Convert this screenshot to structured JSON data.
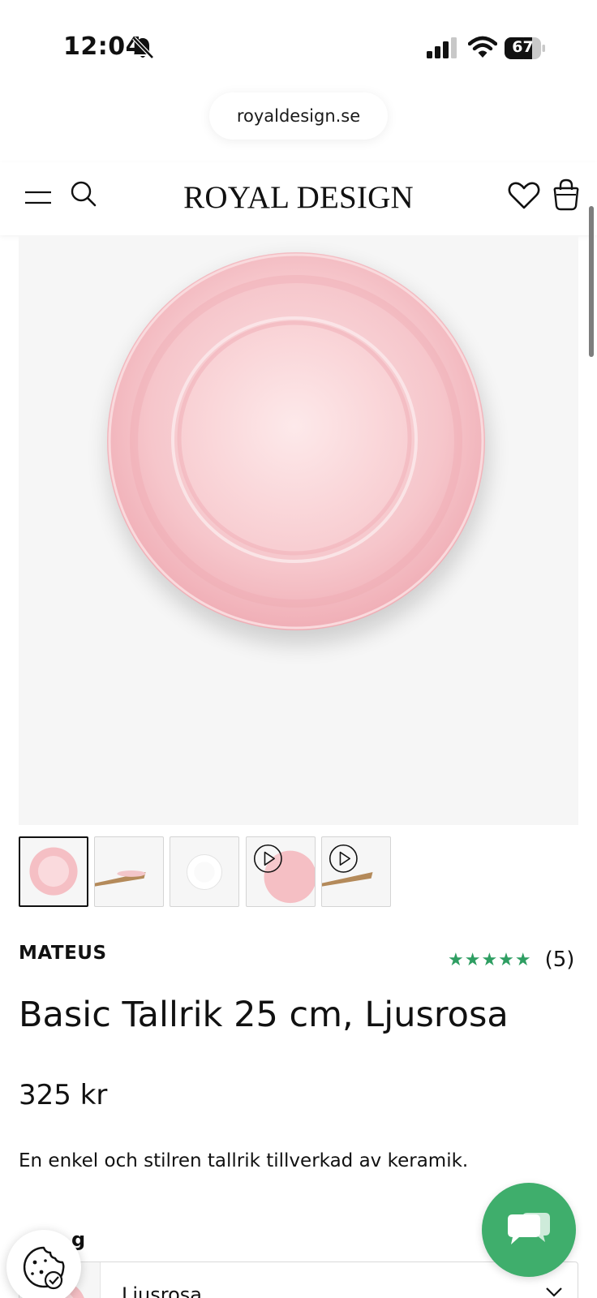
{
  "status_bar": {
    "time": "12:04",
    "battery_percent": "67",
    "icons": [
      "bell-slash-icon",
      "signal-icon",
      "wifi-icon",
      "battery-icon"
    ]
  },
  "browser": {
    "url": "royaldesign.se"
  },
  "header": {
    "logo_text": "ROYAL DESIGN",
    "icons": [
      "menu-icon",
      "search-icon",
      "heart-icon",
      "bag-icon"
    ]
  },
  "gallery": {
    "thumbnail_count": 5,
    "active_index": 0,
    "video_thumbnails": [
      3,
      4
    ]
  },
  "product": {
    "brand": "MATEUS",
    "rating_stars": "★★★★★",
    "rating_value": 5,
    "rating_count": "(5)",
    "title": "Basic Tallrik 25 cm, Ljusrosa",
    "price": "325 kr",
    "description": "En enkel och stilren tallrik tillverkad av keramik."
  },
  "variant": {
    "label_fragment": "g",
    "selected": "Ljusrosa"
  },
  "colors": {
    "plate_pink": "#f4b6bd",
    "accent_green": "#3fae6c",
    "star_green": "#2e9e62",
    "image_bg": "#f6f6f6"
  }
}
